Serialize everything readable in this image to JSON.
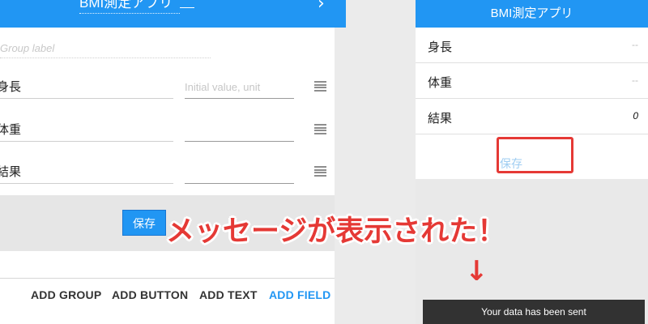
{
  "editor": {
    "title": "BMI測定アプリ",
    "group_label_placeholder": "Group label",
    "fields": [
      {
        "label": "身長",
        "value_placeholder": "Initial value, unit"
      },
      {
        "label": "体重",
        "value_placeholder": ""
      },
      {
        "label": "結果",
        "value_placeholder": ""
      }
    ],
    "save_label": "保存",
    "actions": {
      "add_group": "ADD GROUP",
      "add_button": "ADD BUTTON",
      "add_text": "ADD TEXT",
      "add_field": "ADD FIELD"
    }
  },
  "app": {
    "title": "BMI測定アプリ",
    "rows": [
      {
        "label": "身長",
        "value": "--"
      },
      {
        "label": "体重",
        "value": "--"
      },
      {
        "label": "結果",
        "value": "0"
      }
    ],
    "save_label": "保存",
    "toast": "Your data has been sent"
  },
  "annotation": {
    "callout": "メッセージが表示された！",
    "arrow": "↓"
  },
  "colors": {
    "primary": "#2196f3",
    "annotation_red": "#e53935",
    "toast_bg": "#323232"
  }
}
